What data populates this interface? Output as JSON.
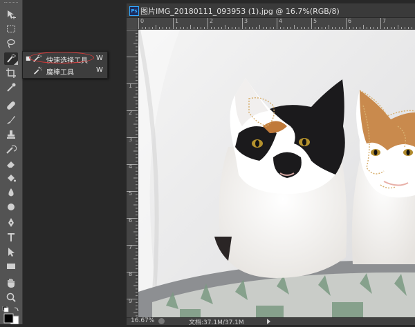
{
  "document": {
    "title": "图片IMG_20180111_093953 (1).jpg @ 16.7%(RGB/8)",
    "app_badge": "Ps"
  },
  "rulers": {
    "top_labels": [
      "0",
      "1",
      "2",
      "3",
      "4",
      "5",
      "6",
      "7",
      "8"
    ],
    "left_labels": [
      "1",
      "2",
      "3",
      "4",
      "5",
      "6",
      "7",
      "8",
      "9"
    ]
  },
  "flyout": {
    "items": [
      {
        "label": "快速选择工具",
        "shortcut": "W",
        "icon": "quick-selection-icon",
        "active": true
      },
      {
        "label": "魔棒工具",
        "shortcut": "W",
        "icon": "magic-wand-icon",
        "active": false
      }
    ]
  },
  "status": {
    "zoom": "16.67%",
    "doc_size": "文档:37.1M/37.1M"
  },
  "colors": {
    "foreground": "#000000",
    "background": "#ffffff",
    "annotation": "#d33a3a"
  }
}
